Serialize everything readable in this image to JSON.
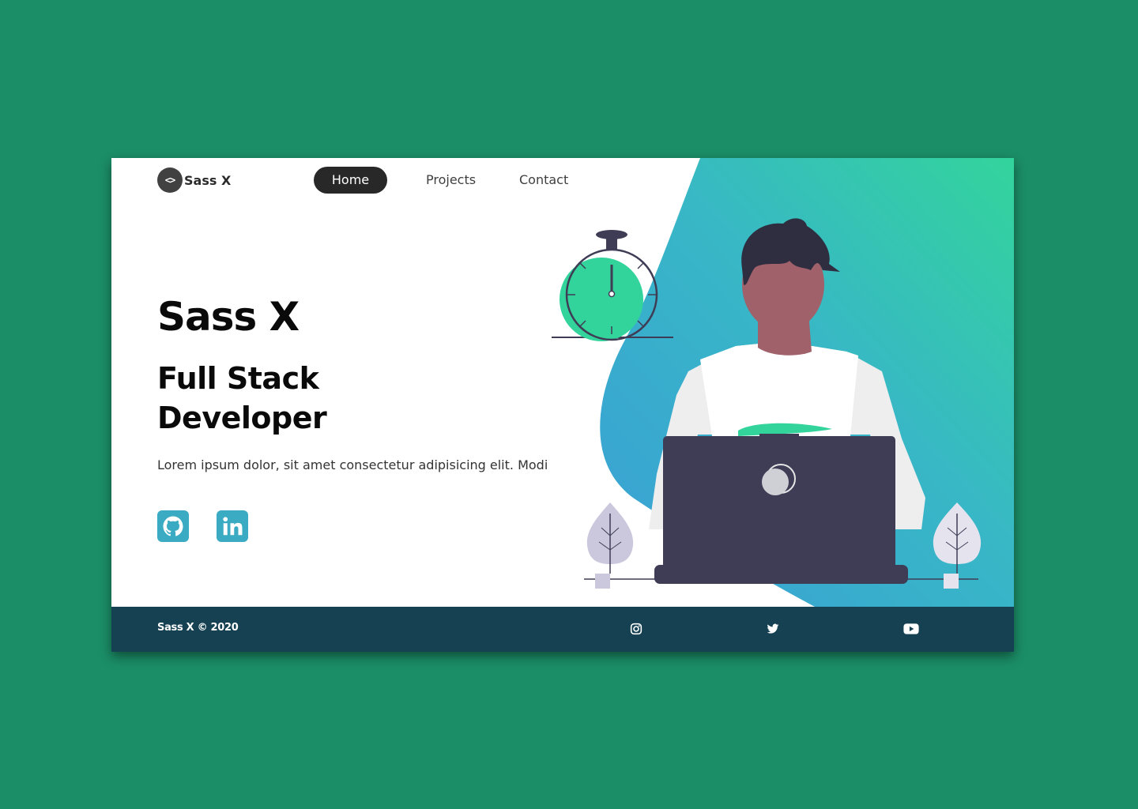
{
  "logo": {
    "icon_text": "<>",
    "text": "Sass X"
  },
  "nav": {
    "items": [
      {
        "label": "Home",
        "active": true
      },
      {
        "label": "Projects",
        "active": false
      },
      {
        "label": "Contact",
        "active": false
      }
    ]
  },
  "hero": {
    "title": "Sass X",
    "subtitle": "Full Stack Developer",
    "description": "Lorem ipsum dolor, sit amet consectetur adipisicing elit. Modi",
    "social": [
      {
        "icon": "github-icon"
      },
      {
        "icon": "linkedin-icon"
      }
    ]
  },
  "footer": {
    "copyright": "Sass X © 2020",
    "icons": [
      "instagram-icon",
      "twitter-icon",
      "youtube-icon"
    ]
  },
  "colors": {
    "page_background": "#1b8e67",
    "accent_teal": "#3aabc2",
    "gradient_start": "#3a9fd6",
    "gradient_end": "#33d49c",
    "footer_background": "#154152",
    "nav_active_background": "#282828",
    "clock_green": "#33d49c",
    "laptop": "#3f3d56"
  }
}
